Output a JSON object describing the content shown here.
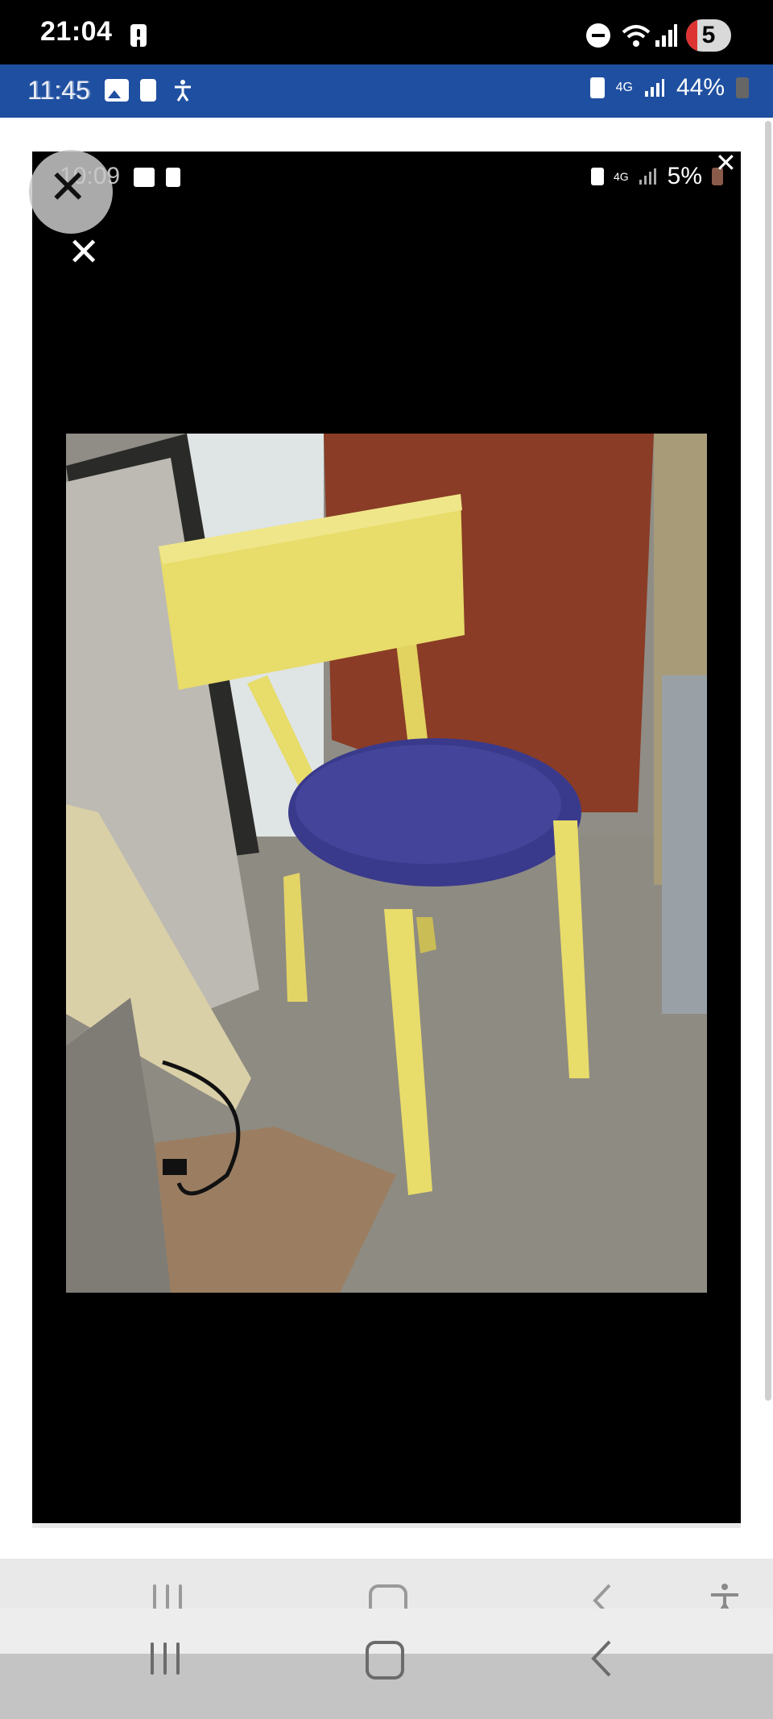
{
  "outer_status_bar": {
    "time": "21:04",
    "notification_count": "5",
    "icons": [
      "alert-icon",
      "do-not-disturb-icon",
      "wifi-icon",
      "signal-icon"
    ]
  },
  "inner_status_bar": {
    "time": "11:45",
    "battery": "44%",
    "network": "4G",
    "icons": [
      "image-icon",
      "alert-icon",
      "accessibility-icon",
      "battery-saver-icon",
      "signal-icon",
      "battery-icon"
    ]
  },
  "image_viewer": {
    "status_bar": {
      "time": "10:09",
      "battery": "5%",
      "network": "4G"
    },
    "close_label": "✕",
    "photo_subject": "yellow wooden chair with blue round seat"
  },
  "navigation": {
    "buttons": [
      "recents",
      "home",
      "back",
      "accessibility"
    ]
  },
  "colors": {
    "blue_bar": "#1f4fa0",
    "chair_wood": "#e8dc6a",
    "chair_seat": "#3a3a8c",
    "door": "#8a3c26"
  }
}
